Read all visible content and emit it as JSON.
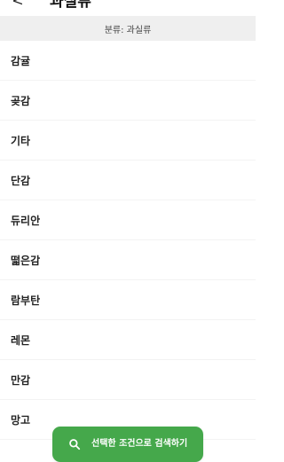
{
  "header": {
    "back_glyph": "<",
    "title": "과실류"
  },
  "filter": {
    "label": "분류: 과실류"
  },
  "list": {
    "items": [
      "감귤",
      "곶감",
      "기타",
      "단감",
      "듀리안",
      "떫은감",
      "람부탄",
      "레몬",
      "만감",
      "망고"
    ]
  },
  "footer": {
    "search_button_label": "선택한 조건으로 검색하기",
    "icon": "search-icon"
  },
  "colors": {
    "accent": "#45a84b",
    "filter_background": "#efefef",
    "text": "#222222"
  }
}
